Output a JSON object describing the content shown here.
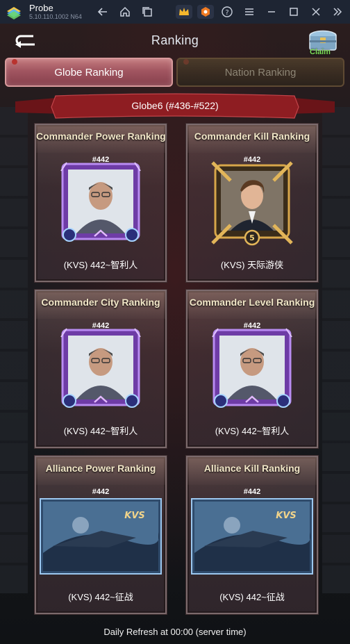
{
  "titlebar": {
    "app_name": "Probe",
    "version": "5.10.110.1002  N64",
    "icons": [
      "logo-icon",
      "back-arrow-icon",
      "home-icon",
      "multi-window-icon",
      "crown-icon",
      "hexagon-icon",
      "help-icon",
      "menu-icon",
      "minimize-icon",
      "maximize-icon",
      "close-icon",
      "collapse-icon"
    ]
  },
  "header": {
    "title": "Ranking",
    "claim_label": "Claim"
  },
  "tabs": [
    {
      "label": "Globe Ranking",
      "active": true
    },
    {
      "label": "Nation Ranking",
      "active": false
    }
  ],
  "globe_banner": "Globe6 (#436-#522)",
  "cards": [
    {
      "title": "Commander Power Ranking",
      "rank": "#442",
      "name": "(KVS) 442~智利人",
      "frame": "purple"
    },
    {
      "title": "Commander Kill Ranking",
      "rank": "#442",
      "name": "(KVS) 天际游侠",
      "frame": "gold"
    },
    {
      "title": "Commander City Ranking",
      "rank": "#442",
      "name": "(KVS) 442~智利人",
      "frame": "purple"
    },
    {
      "title": "Commander Level Ranking",
      "rank": "#442",
      "name": "(KVS) 442~智利人",
      "frame": "purple"
    },
    {
      "title": "Alliance Power Ranking",
      "rank": "#442",
      "name": "(KVS) 442~征战",
      "frame": "alliance",
      "emblem_text": "KVS"
    },
    {
      "title": "Alliance Kill Ranking",
      "rank": "#442",
      "name": "(KVS) 442~征战",
      "frame": "alliance",
      "emblem_text": "KVS"
    }
  ],
  "footer": "Daily Refresh at 00:00 (server time)",
  "colors": {
    "titlebar_bg": "#1e2533",
    "active_tab": "#a15560",
    "inactive_tab": "#3a2d22",
    "banner_red": "#8e1d22",
    "claim_green": "#7fe05a",
    "card_title": "#f2e7c8"
  }
}
